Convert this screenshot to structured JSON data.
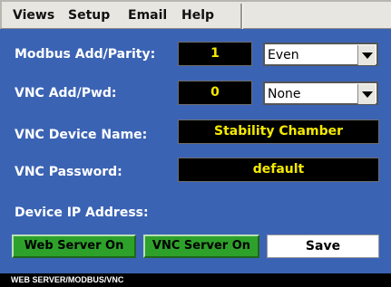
{
  "menubar": {
    "items": [
      "Views",
      "Setup",
      "Email",
      "Help"
    ]
  },
  "form": {
    "modbus_label": "Modbus Add/Parity:",
    "modbus_address": "1",
    "modbus_parity": "Even",
    "vnc_addpwd_label": "VNC Add/Pwd:",
    "vnc_address": "0",
    "vnc_pwd_mode": "None",
    "vnc_device_name_label": "VNC Device Name:",
    "vnc_device_name": "Stability Chamber",
    "vnc_password_label": "VNC Password:",
    "vnc_password": "default",
    "device_ip_label": "Device IP Address:"
  },
  "buttons": {
    "web_server": "Web Server On",
    "vnc_server": "VNC Server On",
    "save": "Save"
  },
  "status_bar": {
    "text": "WEB SERVER/MODBUS/VNC"
  },
  "colors": {
    "background": "#3b63b4",
    "value_text": "#f4e900",
    "value_bg": "#000000",
    "button_on": "#2ea12b"
  }
}
